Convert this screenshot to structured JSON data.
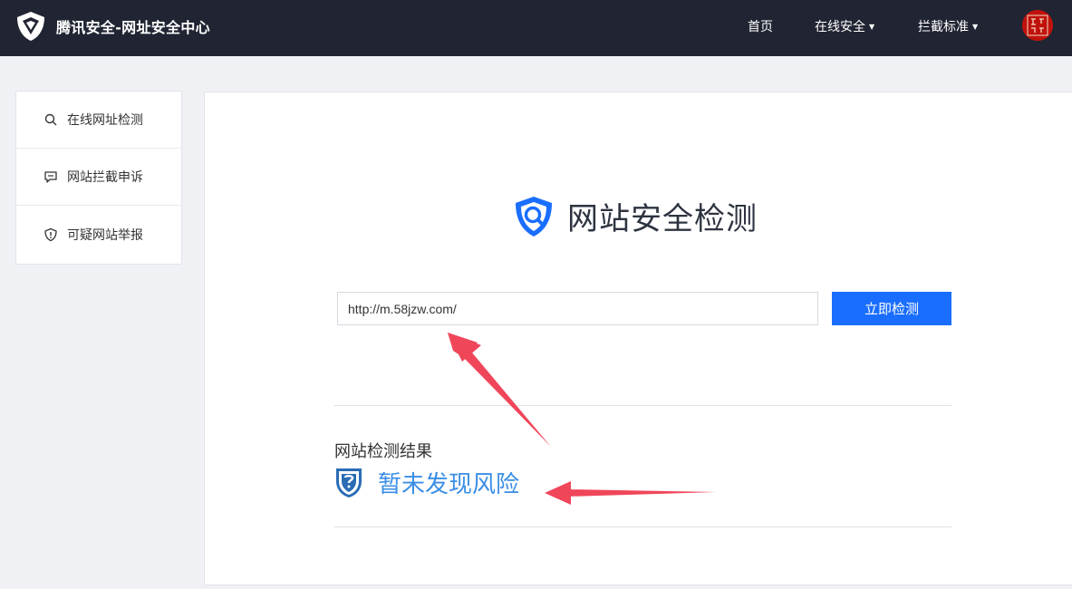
{
  "header": {
    "brand_title": "腾讯安全-网址安全中心",
    "nav": [
      {
        "label": "首页",
        "has_dropdown": false
      },
      {
        "label": "在线安全",
        "has_dropdown": true
      },
      {
        "label": "拦截标准",
        "has_dropdown": true
      }
    ],
    "avatar_icon": "red-seal-avatar"
  },
  "sidebar": {
    "items": [
      {
        "label": "在线网址检测",
        "icon": "search-icon"
      },
      {
        "label": "网站拦截申诉",
        "icon": "message-icon"
      },
      {
        "label": "可疑网站举报",
        "icon": "shield-alert-icon"
      }
    ]
  },
  "main": {
    "title": "网站安全检测",
    "url_value": "http://m.58jzw.com/",
    "check_button": "立即检测",
    "result_label": "网站检测结果",
    "result_text": "暂未发现风险"
  },
  "colors": {
    "topbar": "#212533",
    "accent": "#1a6eff",
    "result_blue": "#3a8ee6",
    "annotation_arrow": "#f0465a"
  }
}
